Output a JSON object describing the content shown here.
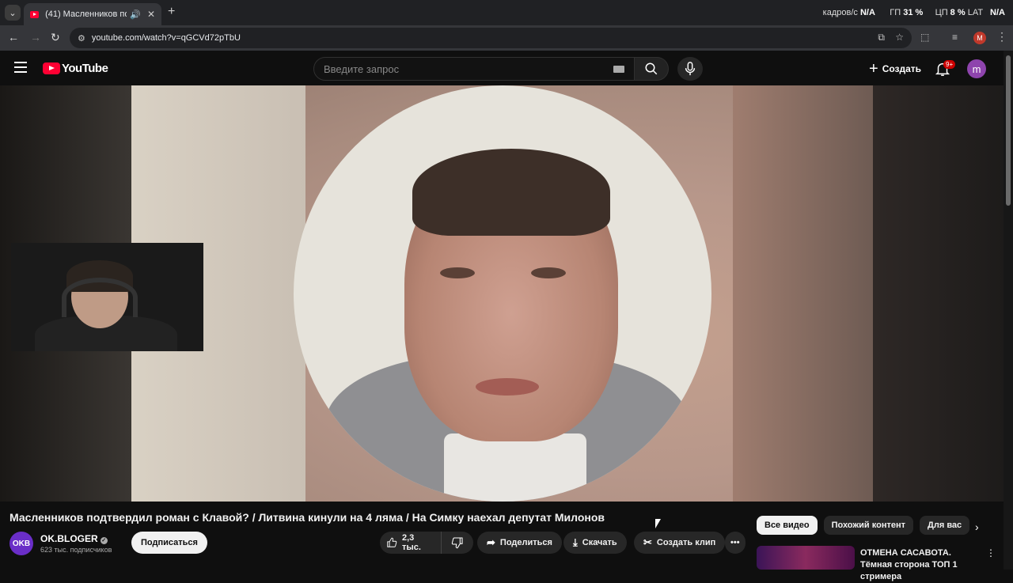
{
  "browser": {
    "tab_title": "(41) Масленников подтвер",
    "new_tab_label": "+",
    "url": "youtube.com/watch?v=qGCVd72pTbU",
    "profile_initial": "M",
    "stats": {
      "fps_label": "кадров/с",
      "fps_value": "N/A",
      "gpu_label": "ГП",
      "gpu_value": "31 %",
      "cpu_label": "ЦП",
      "cpu_value": "8 %",
      "lat_label": "LAT",
      "lat_value": "N/A"
    }
  },
  "youtube": {
    "logo_text": "YouTube",
    "search_placeholder": "Введите запрос",
    "create_label": "Создать",
    "notifications_badge": "9+",
    "avatar_initial": "m"
  },
  "video": {
    "title": "Масленников подтвердил роман с Клавой? / Литвина кинули на 4 ляма / На Симку наехал депутат Милонов"
  },
  "channel": {
    "avatar_text": "OKB",
    "name": "OK.BLOGER",
    "subscribers": "623 тыс. подписчиков",
    "subscribe_label": "Подписаться"
  },
  "actions": {
    "likes": "2,3 тыс.",
    "share_label": "Поделиться",
    "download_label": "Скачать",
    "clip_label": "Создать клип"
  },
  "chips": [
    "Все видео",
    "Похожий контент",
    "Для вас"
  ],
  "recommendation": {
    "title": "ОТМЕНА САСАВОТА. Тёмная сторона ТОП 1 стримера"
  },
  "colors": {
    "yt_red": "#ff0033",
    "bg": "#0f0f0f",
    "chip_active": "#f1f1f1"
  }
}
